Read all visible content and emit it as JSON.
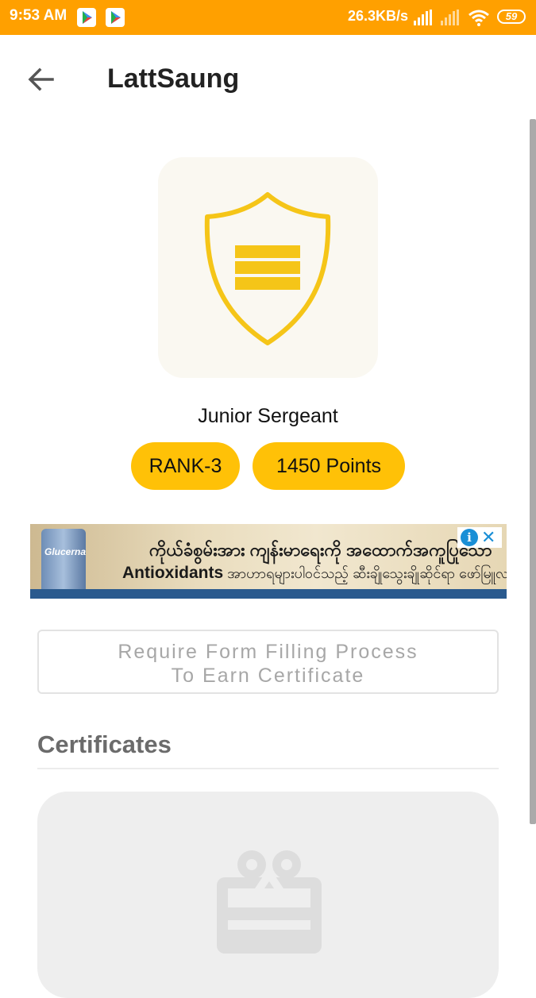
{
  "status_bar": {
    "time": "9:53 AM",
    "network_speed": "26.3KB/s",
    "battery": "59",
    "notification_icons": [
      "play-store-icon",
      "play-store-icon"
    ]
  },
  "app_bar": {
    "title": "LattSaung"
  },
  "rank": {
    "name": "Junior Sergeant",
    "rank_label": "RANK-3",
    "points_label": "1450 Points"
  },
  "ad": {
    "headline": "ကိုယ်ခံစွမ်းအား ကျန်းမာရေးကို အထောက်အကူပြုသော",
    "subline_bold": "Antioxidants",
    "subline_rest": " အာဟာရများပါဝင်သည့် ဆီးချိုသွေးချိုဆိုင်ရာ ဖော်မြူလာ",
    "product": "Glucerna",
    "info_glyph": "i",
    "close_glyph": "✕"
  },
  "form_notice": {
    "line1": "Require Form Filling Process",
    "line2": "To Earn Certificate"
  },
  "certificates": {
    "title": "Certificates"
  },
  "colors": {
    "status_bar": "#ffa000",
    "accent": "#ffc107",
    "badge_stroke": "#f5c518",
    "badge_fill": "#faf8f1"
  }
}
